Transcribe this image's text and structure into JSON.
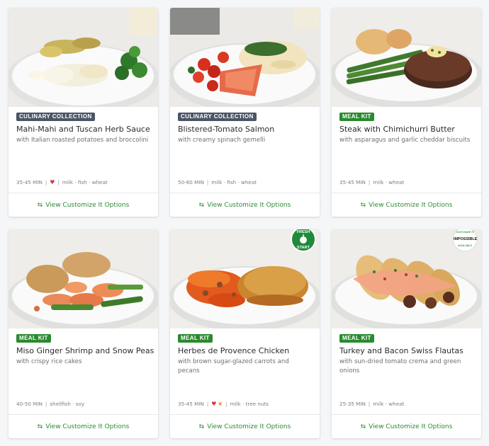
{
  "colors": {
    "culinary_badge": "#4a5566",
    "meal_kit_badge": "#2a8a2e",
    "cta_green": "#2e8a33",
    "heart_red": "#d9333f",
    "wheat_orange": "#e48a2a"
  },
  "cta_icon": "swap-arrows-icon",
  "cards": [
    {
      "badge": "CULINARY COLLECTION",
      "badge_type": "culinary",
      "title": "Mahi-Mahi and Tuscan Herb Sauce",
      "subtitle": "with Italian roasted potatoes and broccolini",
      "time": "35-45 MIN",
      "icons": [
        "heart-icon"
      ],
      "allergens": "milk · fish · wheat",
      "cta": "View Customize It Options"
    },
    {
      "badge": "CULINARY COLLECTION",
      "badge_type": "culinary",
      "title": "Blistered-Tomato Salmon",
      "subtitle": "with creamy spinach gemelli",
      "time": "50-60 MIN",
      "icons": [],
      "allergens": "milk · fish · wheat",
      "cta": "View Customize It Options"
    },
    {
      "badge": "MEAL KIT",
      "badge_type": "mealkit",
      "title": "Steak with Chimichurri Butter",
      "subtitle": "with asparagus and garlic cheddar biscuits",
      "time": "35-45 MIN",
      "icons": [],
      "allergens": "milk · wheat",
      "cta": "View Customize It Options"
    },
    {
      "badge": "MEAL KIT",
      "badge_type": "mealkit",
      "title": "Miso Ginger Shrimp and Snow Peas",
      "subtitle": "with crispy rice cakes",
      "time": "40-50 MIN",
      "icons": [],
      "allergens": "shellfish · soy",
      "cta": "View Customize It Options"
    },
    {
      "badge": "MEAL KIT",
      "badge_type": "mealkit",
      "title": "Herbes de Provence Chicken",
      "subtitle": "with brown sugar-glazed carrots and pecans",
      "time": "35-45 MIN",
      "icons": [
        "heart-icon",
        "wheat-free-icon"
      ],
      "allergens": "milk · tree nuts",
      "cta": "View Customize It Options",
      "sticker": {
        "line1": "FRESH",
        "line2": "START"
      }
    },
    {
      "badge": "MEAL KIT",
      "badge_type": "mealkit",
      "title": "Turkey and Bacon Swiss Flautas",
      "subtitle": "with sun-dried tomato crema and green onions",
      "time": "25-35 MIN",
      "icons": [],
      "allergens": "milk · wheat",
      "cta": "View Customize It Options",
      "sticker": {
        "line1": "CUSTOMIZE IT",
        "line2": "IMPOSSIBLE",
        "line3": "AVAILABLE"
      }
    }
  ]
}
